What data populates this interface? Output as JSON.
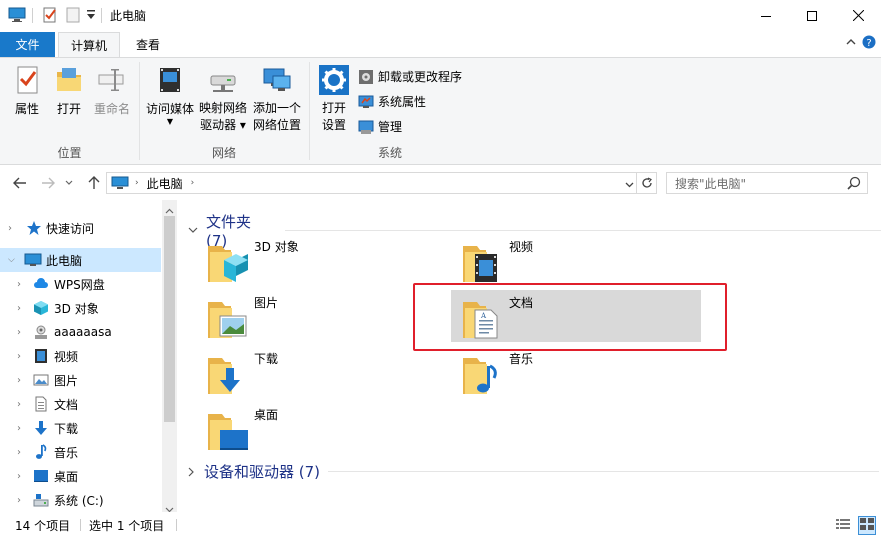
{
  "window": {
    "title": "此电脑",
    "minimize": "—",
    "maximize": "☐",
    "close": "✕"
  },
  "ribbon_tabs": {
    "file": "文件",
    "computer": "计算机",
    "view": "查看"
  },
  "ribbon": {
    "groups": {
      "location": "位置",
      "network": "网络",
      "system": "系统"
    },
    "buttons": {
      "properties": "属性",
      "open": "打开",
      "rename": "重命名",
      "access_media_1": "访问媒体",
      "map_drive_1": "映射网络",
      "map_drive_2": "驱动器 ▾",
      "add_location_1": "添加一个",
      "add_location_2": "网络位置",
      "open_settings_1": "打开",
      "open_settings_2": "设置",
      "uninstall": "卸载或更改程序",
      "system_props": "系统属性",
      "manage": "管理"
    }
  },
  "address": {
    "path": "此电脑",
    "search_placeholder": "搜索\"此电脑\""
  },
  "nav": {
    "items": [
      {
        "label": "快速访问"
      },
      {
        "label": "此电脑"
      },
      {
        "label": "WPS网盘"
      },
      {
        "label": "3D 对象"
      },
      {
        "label": "aaaaaasa"
      },
      {
        "label": "视频"
      },
      {
        "label": "图片"
      },
      {
        "label": "文档"
      },
      {
        "label": "下载"
      },
      {
        "label": "音乐"
      },
      {
        "label": "桌面"
      },
      {
        "label": "系统 (C:)"
      }
    ]
  },
  "content": {
    "folders_header": "文件夹 (7)",
    "devices_header": "设备和驱动器 (7)",
    "folders": [
      {
        "label": "3D 对象",
        "icon": "3d-objects-icon"
      },
      {
        "label": "视频",
        "icon": "video-icon"
      },
      {
        "label": "图片",
        "icon": "pictures-icon"
      },
      {
        "label": "文档",
        "icon": "documents-icon"
      },
      {
        "label": "下载",
        "icon": "downloads-icon"
      },
      {
        "label": "音乐",
        "icon": "music-icon"
      },
      {
        "label": "桌面",
        "icon": "desktop-icon"
      }
    ]
  },
  "status": {
    "count": "14 个项目",
    "selected": "选中 1 个项目"
  },
  "colors": {
    "accent": "#1979ca",
    "selection": "#cce8ff",
    "highlight_box": "#e01f2b",
    "header_text": "#1e3287"
  }
}
